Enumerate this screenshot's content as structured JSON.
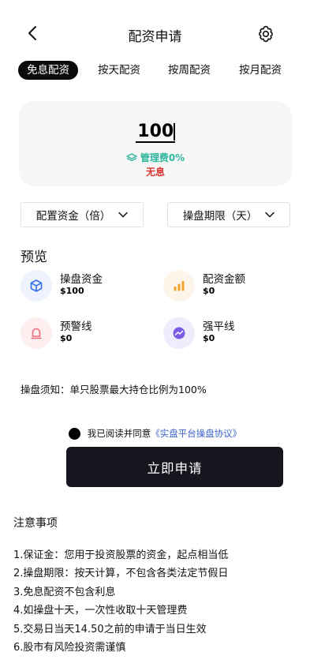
{
  "header": {
    "title": "配资申请",
    "back_icon": "chevron-left-icon",
    "settings_icon": "gear-icon"
  },
  "tabs": [
    {
      "label": "免息配资",
      "active": true
    },
    {
      "label": "按天配资",
      "active": false
    },
    {
      "label": "按周配资",
      "active": false
    },
    {
      "label": "按月配资",
      "active": false
    }
  ],
  "amount": {
    "value": "100",
    "fee_label": "管理费0%",
    "interest_label": "无息"
  },
  "selects": {
    "leverage": "配置资金（倍）",
    "period": "操盘期限（天）"
  },
  "preview": {
    "title": "预览",
    "items": [
      {
        "label": "操盘资金",
        "value": "$100",
        "icon": "cube-icon",
        "color": "#3b74e8",
        "bg": "#eef3fd"
      },
      {
        "label": "配资金额",
        "value": "$0",
        "icon": "bar-chart-icon",
        "color": "#f2a22c",
        "bg": "#fdf5ea"
      },
      {
        "label": "预警线",
        "value": "$0",
        "icon": "bell-icon",
        "color": "#ee6b7c",
        "bg": "#fdeef0"
      },
      {
        "label": "强平线",
        "value": "$0",
        "icon": "trend-icon",
        "color": "#7b5ce6",
        "bg": "#efecfc"
      }
    ]
  },
  "notice": "操盘须知：单只股票最大持仓比例为100%",
  "agreement": {
    "text": "我已阅读并同意",
    "link": "《实盘平台操盘协议》"
  },
  "submit_label": "立即申请",
  "notes": {
    "title": "注意事项",
    "items": [
      "1.保证金：您用于投资股票的资金，起点相当低",
      "2.操盘期限：按天计算，不包含各类法定节假日",
      "3.免息配资不包含利息",
      "4.如操盘十天，一次性收取十天管理费",
      "5.交易日当天14.50之前的申请于当日生效",
      "6.股市有风险投资需谨慎"
    ]
  },
  "colors": {
    "accent_dark": "#16161e",
    "fee_green": "#2fb89c",
    "interest_red": "#e0312c",
    "link_blue": "#3b64c8"
  }
}
